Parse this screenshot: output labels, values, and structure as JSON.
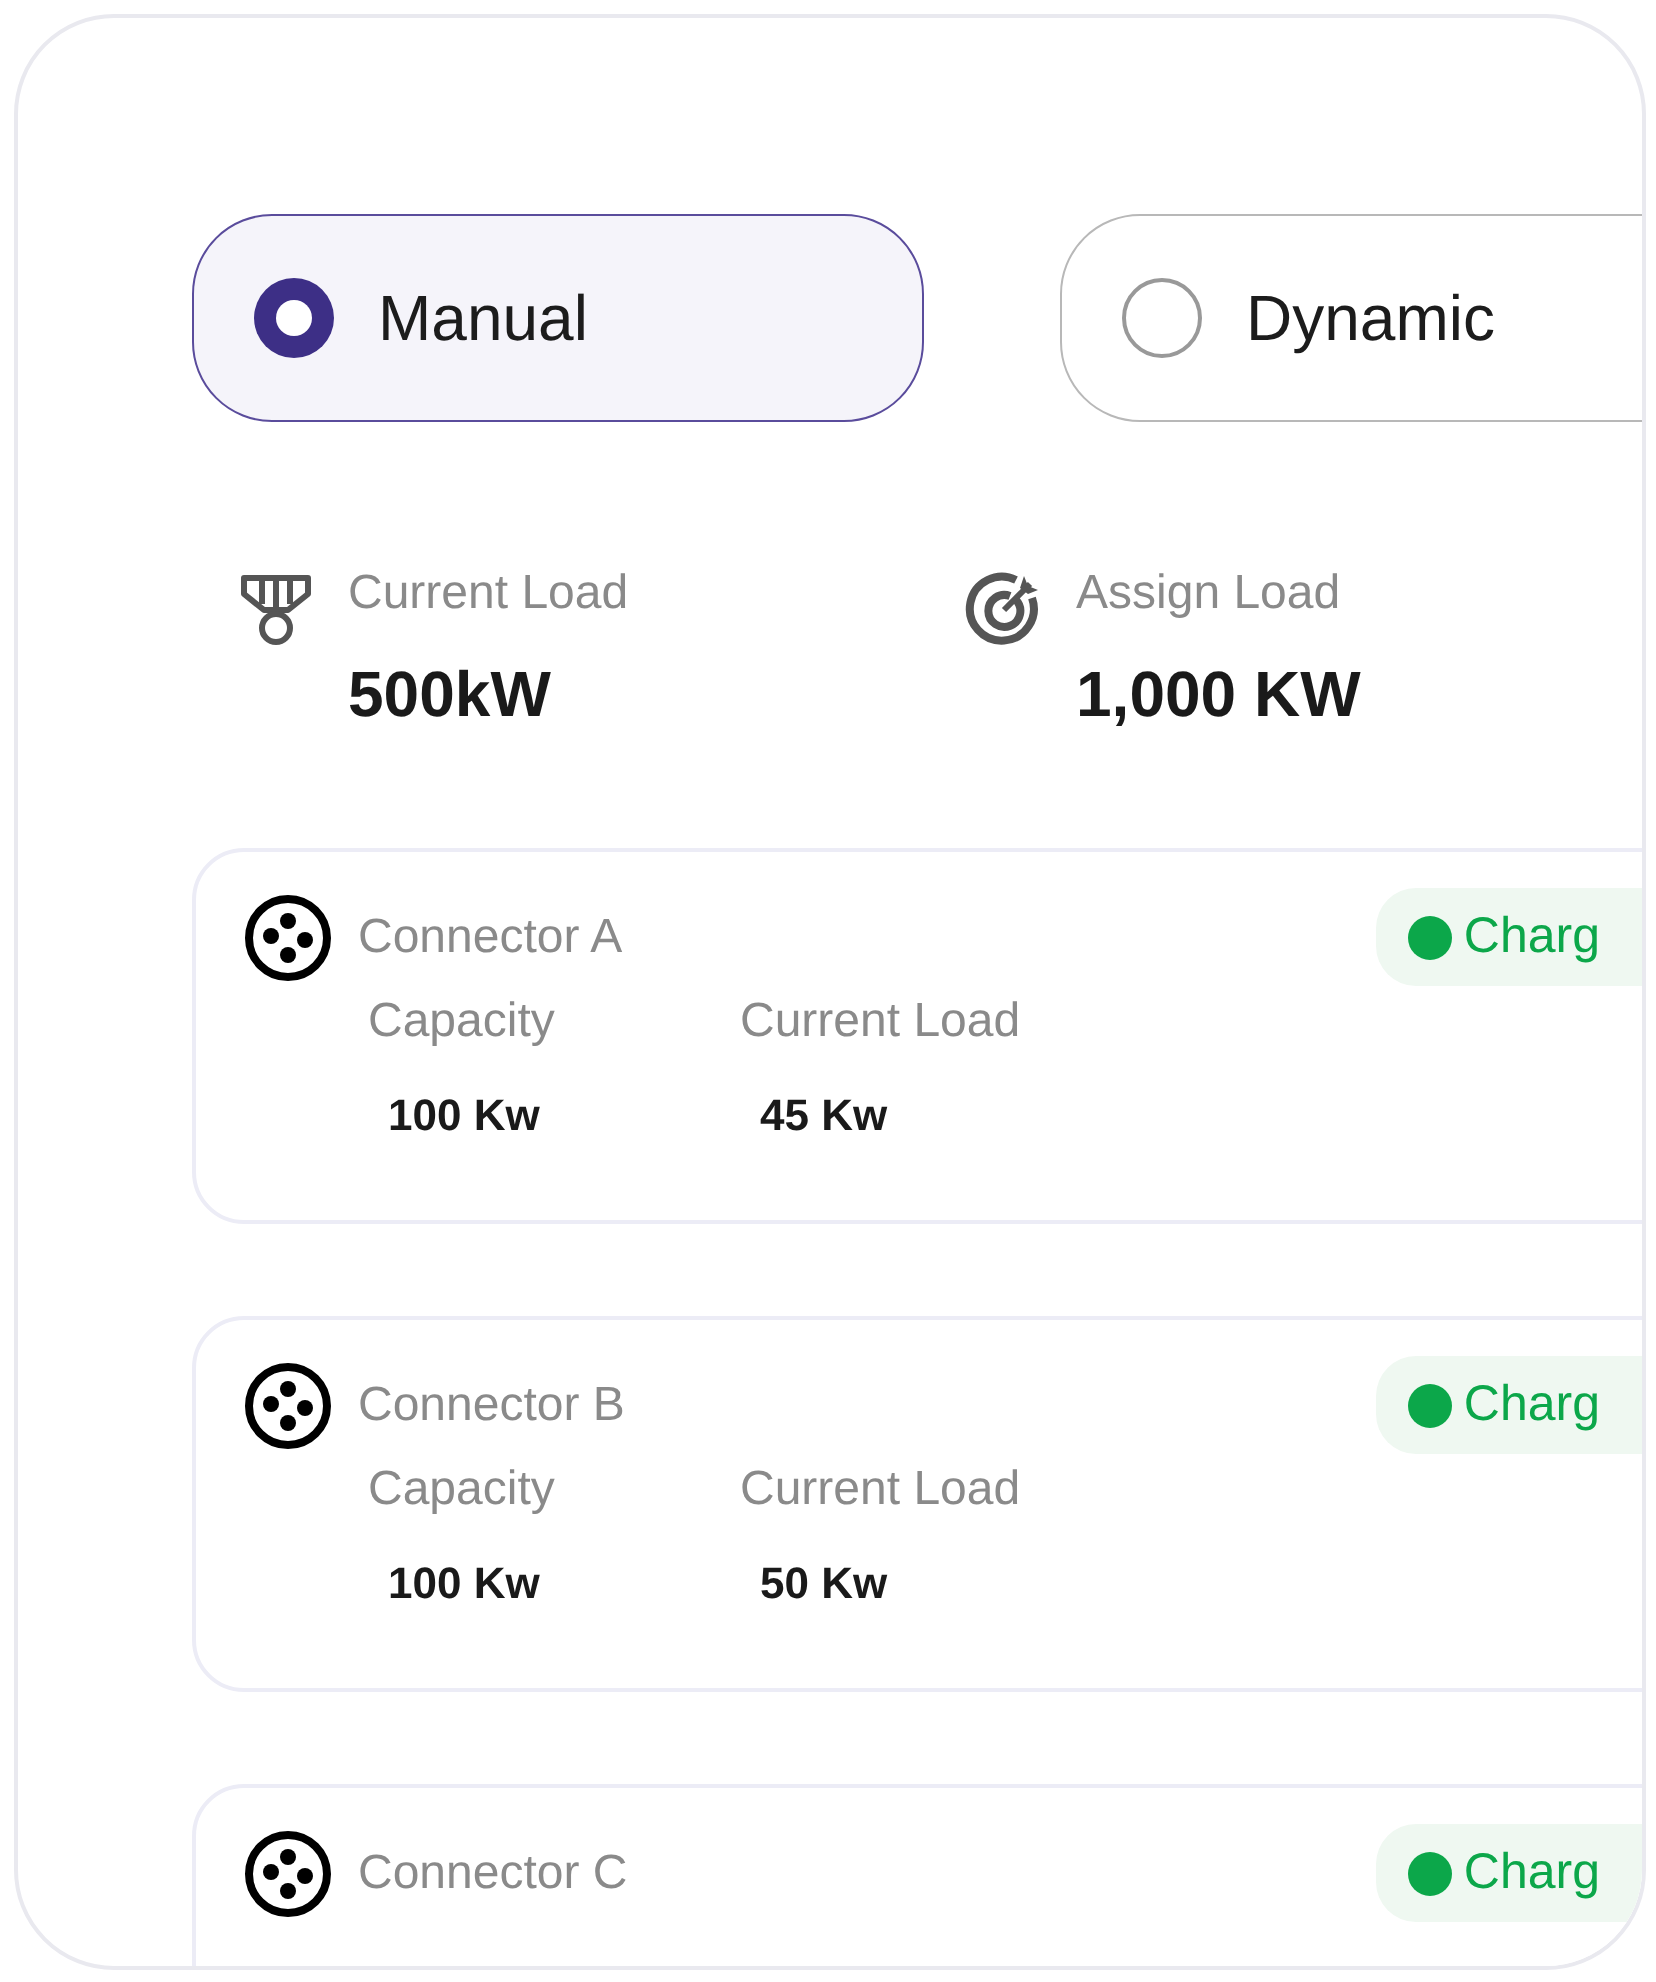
{
  "modes": [
    {
      "label": "Manual",
      "selected": true
    },
    {
      "label": "Dynamic",
      "selected": false
    }
  ],
  "stats": [
    {
      "kind": "medal",
      "label": "Current Load",
      "value": "500kW"
    },
    {
      "kind": "target",
      "label": "Assign Load",
      "value": "1,000 KW"
    }
  ],
  "connectors": [
    {
      "name": "Connector A",
      "status": "Charg",
      "color": "#0ca74a",
      "capacity_label": "Capacity",
      "capacity": "100 Kw",
      "load_label": "Current Load",
      "load": "45 Kw"
    },
    {
      "name": "Connector B",
      "status": "Charg",
      "color": "#0ca74a",
      "capacity_label": "Capacity",
      "capacity": "100 Kw",
      "load_label": "Current Load",
      "load": "50 Kw"
    },
    {
      "name": "Connector C",
      "status": "Charg",
      "color": "#0ca74a"
    }
  ]
}
